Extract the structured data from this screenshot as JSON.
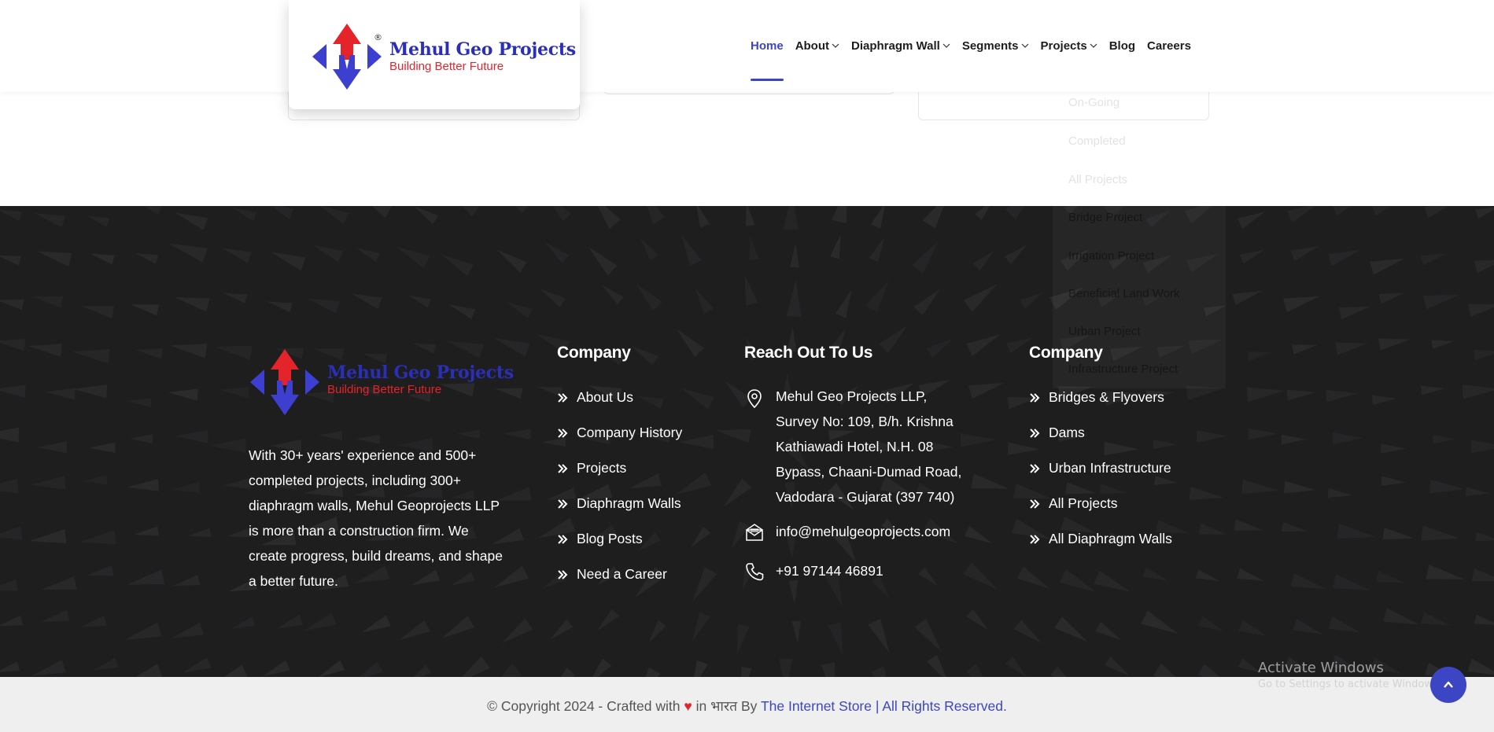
{
  "brand": {
    "name": "Mehul Geo Projects",
    "tagline": "Building Better Future",
    "registered": "®",
    "colors": {
      "primary_blue": "#2b2fb8",
      "accent_red": "#e5232b",
      "nav_active": "#3c45c4"
    }
  },
  "nav": {
    "items": [
      {
        "label": "Home",
        "active": true,
        "has_dropdown": false
      },
      {
        "label": "About",
        "active": false,
        "has_dropdown": true
      },
      {
        "label": "Diaphragm Wall",
        "active": false,
        "has_dropdown": true
      },
      {
        "label": "Segments",
        "active": false,
        "has_dropdown": true
      },
      {
        "label": "Projects",
        "active": false,
        "has_dropdown": true
      },
      {
        "label": "Blog",
        "active": false,
        "has_dropdown": false
      },
      {
        "label": "Careers",
        "active": false,
        "has_dropdown": false
      }
    ]
  },
  "projects_dropdown": {
    "items": [
      "On-Going",
      "Completed",
      "All Projects",
      "Bridge Project",
      "Irrigation Project",
      "Beneficial Land Work",
      "Urban Project",
      "Infrastructure Project"
    ]
  },
  "footer": {
    "about_text": "With 30+ years' experience and 500+ completed projects, including 300+ diaphragm walls, Mehul Geoprojects LLP is more than a construction firm. We create progress, build dreams, and shape a better future.",
    "company": {
      "title": "Company",
      "links": [
        "About Us",
        "Company History",
        "Projects",
        "Diaphragm Walls",
        "Blog Posts",
        "Need a Career"
      ]
    },
    "reach": {
      "title": "Reach Out To Us",
      "address": "Mehul Geo Projects LLP, Survey No: 109, B/h. Krishna Kathiawadi Hotel, N.H. 08 Bypass, Chaani-Dumad Road, Vadodara - Gujarat (397 740)",
      "email": "info@mehulgeoprojects.com",
      "phone": "+91 97144 46891"
    },
    "company2": {
      "title": "Company",
      "links": [
        "Bridges & Flyovers",
        "Dams",
        "Urban Infrastructure",
        "All Projects",
        "All Diaphragm Walls"
      ]
    }
  },
  "copyright": {
    "prefix": "© Copyright 2024 - Crafted with",
    "heart": "♥",
    "middle": "in भारत By",
    "link1": "The Internet Store",
    "separator": "|",
    "link2": "All Rights Reserved."
  },
  "os_watermark": {
    "line1": "Activate Windows",
    "line2": "Go to Settings to activate Windows."
  }
}
